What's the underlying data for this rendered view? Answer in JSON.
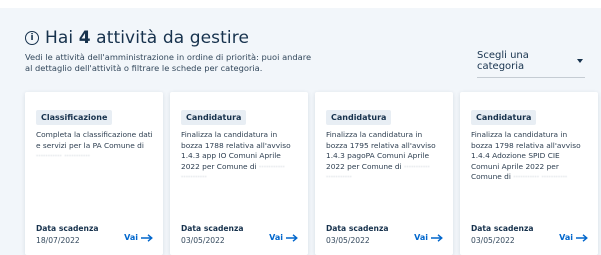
{
  "header": {
    "title_prefix": "Hai ",
    "count": "4",
    "title_suffix": " attività da gestire",
    "subtitle": "Vedi le attività dell'amministrazione in ordine di priorità: puoi andare al dettaglio dell'attività o filtrare le schede per categoria."
  },
  "filter": {
    "label": "Scegli una categoria"
  },
  "cards": [
    {
      "category": "Classificazione",
      "desc_main": "Completa la classificazione dati e servizi per la PA Comune di ",
      "desc_blur": "··········· ···········",
      "deadline_label": "Data scadenza",
      "deadline": "18/07/2022",
      "action": "Vai"
    },
    {
      "category": "Candidatura",
      "desc_main": "Finalizza la candidatura in bozza 1788 relativa all'avviso 1.4.3 app IO Comuni Aprile 2022 per Comune di ",
      "desc_blur": "··········· ···········",
      "deadline_label": "Data scadenza",
      "deadline": "03/05/2022",
      "action": "Vai"
    },
    {
      "category": "Candidatura",
      "desc_main": "Finalizza la candidatura in bozza 1795 relativa all'avviso 1.4.3 pagoPA Comuni Aprile 2022 per Comune di ",
      "desc_blur": "··········· ···········",
      "deadline_label": "Data scadenza",
      "deadline": "03/05/2022",
      "action": "Vai"
    },
    {
      "category": "Candidatura",
      "desc_main": "Finalizza la candidatura in bozza 1798 relativa all'avviso 1.4.4 Adozione SPID CIE Comuni Aprile 2022 per Comune di ",
      "desc_blur": "··········· ···········",
      "deadline_label": "Data scadenza",
      "deadline": "03/05/2022",
      "action": "Vai"
    }
  ],
  "icons": {
    "info": "info-icon",
    "caret": "chevron-down-icon",
    "arrow": "arrow-right-icon"
  },
  "colors": {
    "text": "#17324d",
    "link": "#0066cc",
    "background": "#f2f6fa"
  }
}
